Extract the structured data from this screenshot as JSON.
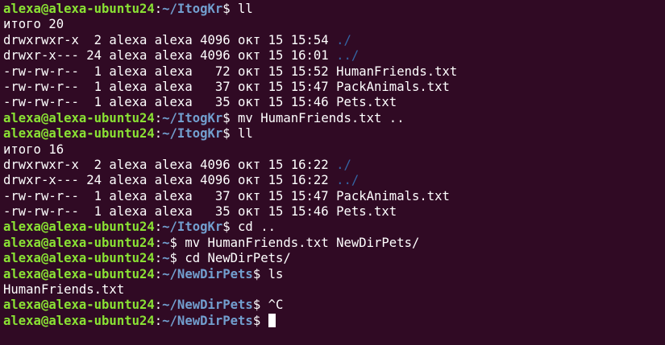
{
  "colors": {
    "background": "#300a24",
    "prompt_user": "#8ae234",
    "prompt_path": "#729fcf",
    "text": "#ffffff",
    "dir_link": "#3465a4"
  },
  "lines": [
    {
      "type": "prompt",
      "user": "alexa@alexa-ubuntu24",
      "path": "~/ItogKr",
      "cmd": " ll"
    },
    {
      "type": "text",
      "text": "итого 20"
    },
    {
      "type": "ls",
      "text": "drwxrwxr-x  2 alexa alexa 4096 окт 15 15:54 ",
      "name": "./",
      "isdir": true
    },
    {
      "type": "ls",
      "text": "drwxr-x--- 24 alexa alexa 4096 окт 15 16:01 ",
      "name": "../",
      "isdir": true
    },
    {
      "type": "ls",
      "text": "-rw-rw-r--  1 alexa alexa   72 окт 15 15:52 ",
      "name": "HumanFriends.txt",
      "isdir": false
    },
    {
      "type": "ls",
      "text": "-rw-rw-r--  1 alexa alexa   37 окт 15 15:47 ",
      "name": "PackAnimals.txt",
      "isdir": false
    },
    {
      "type": "ls",
      "text": "-rw-rw-r--  1 alexa alexa   35 окт 15 15:46 ",
      "name": "Pets.txt",
      "isdir": false
    },
    {
      "type": "prompt",
      "user": "alexa@alexa-ubuntu24",
      "path": "~/ItogKr",
      "cmd": " mv HumanFriends.txt .."
    },
    {
      "type": "prompt",
      "user": "alexa@alexa-ubuntu24",
      "path": "~/ItogKr",
      "cmd": " ll"
    },
    {
      "type": "text",
      "text": "итого 16"
    },
    {
      "type": "ls",
      "text": "drwxrwxr-x  2 alexa alexa 4096 окт 15 16:22 ",
      "name": "./",
      "isdir": true
    },
    {
      "type": "ls",
      "text": "drwxr-x--- 24 alexa alexa 4096 окт 15 16:22 ",
      "name": "../",
      "isdir": true
    },
    {
      "type": "ls",
      "text": "-rw-rw-r--  1 alexa alexa   37 окт 15 15:47 ",
      "name": "PackAnimals.txt",
      "isdir": false
    },
    {
      "type": "ls",
      "text": "-rw-rw-r--  1 alexa alexa   35 окт 15 15:46 ",
      "name": "Pets.txt",
      "isdir": false
    },
    {
      "type": "prompt",
      "user": "alexa@alexa-ubuntu24",
      "path": "~/ItogKr",
      "cmd": " cd .."
    },
    {
      "type": "prompt",
      "user": "alexa@alexa-ubuntu24",
      "path": "~",
      "cmd": " mv HumanFriends.txt NewDirPets/"
    },
    {
      "type": "prompt",
      "user": "alexa@alexa-ubuntu24",
      "path": "~",
      "cmd": " cd NewDirPets/"
    },
    {
      "type": "prompt",
      "user": "alexa@alexa-ubuntu24",
      "path": "~/NewDirPets",
      "cmd": " ls"
    },
    {
      "type": "text",
      "text": "HumanFriends.txt"
    },
    {
      "type": "prompt",
      "user": "alexa@alexa-ubuntu24",
      "path": "~/NewDirPets",
      "cmd": " ^C"
    },
    {
      "type": "prompt",
      "user": "alexa@alexa-ubuntu24",
      "path": "~/NewDirPets",
      "cmd": " ",
      "cursor": true
    }
  ]
}
